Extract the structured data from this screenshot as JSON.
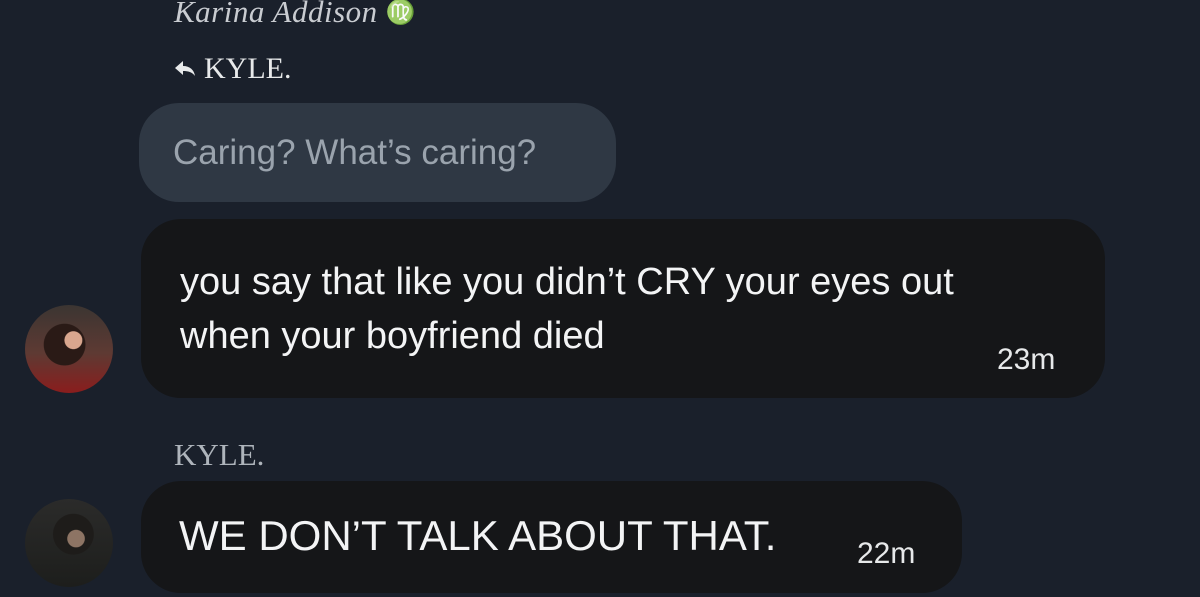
{
  "header": {
    "sender_name": "Karina Addison",
    "sender_symbol": "♍",
    "reply_to": "KYLE."
  },
  "quoted": {
    "text": "Caring? What’s caring?"
  },
  "messages": [
    {
      "text": "you say that like you didn’t CRY your eyes out when your boyfriend died",
      "time": "23m"
    },
    {
      "name": "KYLE.",
      "text": "WE DON’T TALK ABOUT THAT.",
      "time": "22m"
    }
  ],
  "icons": {
    "reply": "reply-arrow-icon"
  }
}
